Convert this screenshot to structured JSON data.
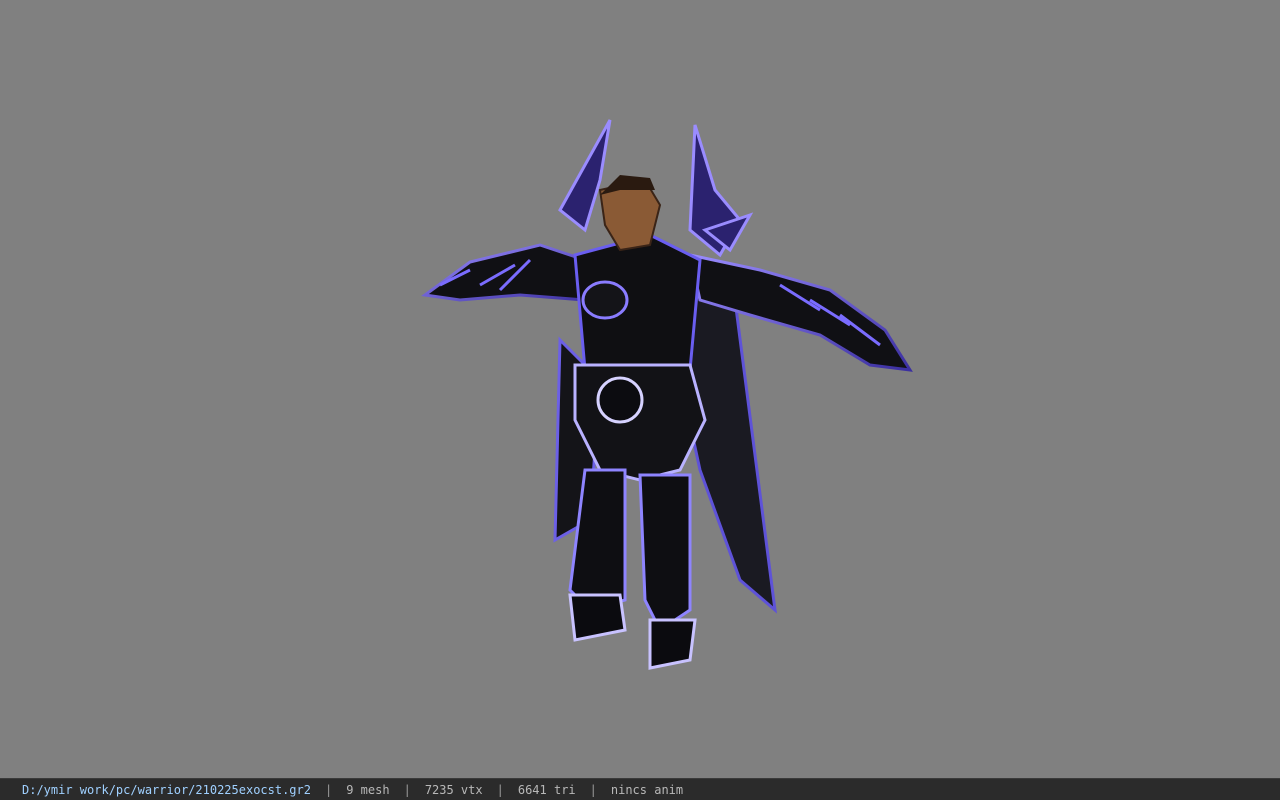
{
  "viewer": {
    "background_color": "#808080",
    "model_icon": "armored-warrior-model"
  },
  "status": {
    "file_path": "D:/ymir work/pc/warrior/210225exocst.gr2",
    "separator": "|",
    "mesh_count": "9 mesh",
    "vertex_count": "7235 vtx",
    "triangle_count": "6641 tri",
    "anim_label": "nincs anim"
  }
}
